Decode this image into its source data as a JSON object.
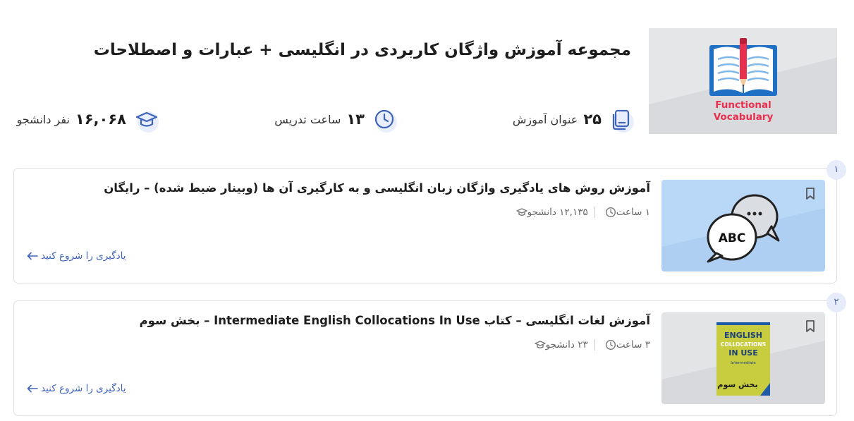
{
  "course": {
    "title": "مجموعه آموزش واژگان کاربردی در انگلیسی + عبارات و اصطلاحات",
    "cover_text_line1": "Functional",
    "cover_text_line2": "Vocabulary",
    "stats": {
      "lessons": {
        "value": "۲۵",
        "unit": "عنوان آموزش",
        "icon": "stacked-pages-icon"
      },
      "hours": {
        "value": "۱۳",
        "unit": "ساعت تدریس",
        "icon": "clock-icon"
      },
      "students": {
        "value": "۱۶,۰۶۸",
        "unit": "نفر دانشجو",
        "icon": "graduation-cap-icon"
      }
    }
  },
  "lessons": [
    {
      "index": "۱",
      "title": "آموزش روش های یادگیری واژگان زبان انگلیسی و به کارگیری آن ها (وبینار ضبط شده) – رایگان",
      "students": "۱۲,۱۳۵ دانشجو",
      "duration": "۱ ساعت",
      "start_label": "یادگیری را شروع کنید",
      "thumb_text": "ABC"
    },
    {
      "index": "۲",
      "title": "آموزش لغات انگلیسی – کتاب Intermediate English Collocations In Use – بخش سوم",
      "students": "۲۳ دانشجو",
      "duration": "۳ ساعت",
      "start_label": "یادگیری را شروع کنید",
      "thumb_book_line1": "ENGLISH",
      "thumb_book_line2": "COLLOCATIONS",
      "thumb_book_line3": "IN USE",
      "thumb_book_level": "Intermediate",
      "thumb_book_part": "بخش سوم"
    }
  ],
  "colors": {
    "accent": "#3e63b8",
    "cover_text": "#e8304e",
    "book_blue": "#1f6fc4",
    "thumb1_bg": "#b9d8f7",
    "thumb2_bg": "#e3e4e6"
  }
}
